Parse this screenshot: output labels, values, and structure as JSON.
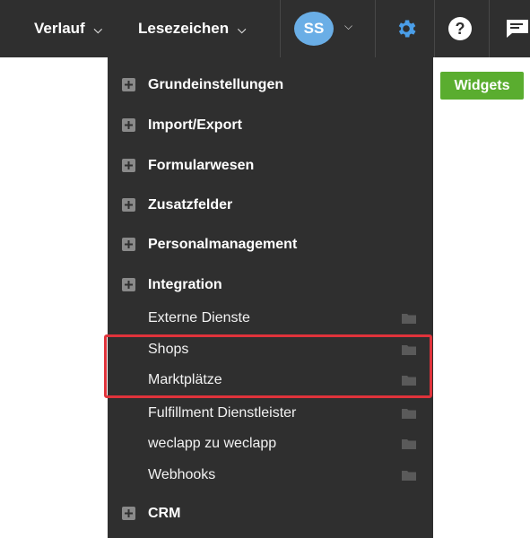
{
  "topbar": {
    "history_label": "Verlauf",
    "bookmarks_label": "Lesezeichen",
    "avatar_initials": "SS",
    "help_glyph": "?",
    "icons": {
      "history_chevron": "chevron-down-icon",
      "bookmarks_chevron": "chevron-down-icon",
      "user_chevron": "chevron-down-icon",
      "settings": "gear-icon",
      "help": "help-icon",
      "messages": "chat-icon"
    },
    "colors": {
      "bar": "#2f2f2f",
      "avatar": "#6aaee6",
      "gear": "#4a9ee8"
    }
  },
  "widgets_button": {
    "label": "Widgets",
    "color": "#5aad2f"
  },
  "settings_menu": {
    "items": [
      {
        "label": "Grundeinstellungen",
        "type": "section",
        "icon": "expand-plus-icon"
      },
      {
        "label": "Import/Export",
        "type": "section",
        "icon": "expand-plus-icon"
      },
      {
        "label": "Formularwesen",
        "type": "section",
        "icon": "expand-plus-icon"
      },
      {
        "label": "Zusatzfelder",
        "type": "section",
        "icon": "expand-plus-icon"
      },
      {
        "label": "Personalmanagement",
        "type": "section",
        "icon": "expand-plus-icon"
      },
      {
        "label": "Integration",
        "type": "section",
        "icon": "expand-plus-icon",
        "expanded": true
      },
      {
        "label": "Externe Dienste",
        "type": "subitem",
        "icon": "folder-icon"
      },
      {
        "label": "Shops",
        "type": "subitem",
        "icon": "folder-icon",
        "highlighted": true
      },
      {
        "label": "Marktplätze",
        "type": "subitem",
        "icon": "folder-icon",
        "highlighted": true
      },
      {
        "label": "Fulfillment Dienstleister",
        "type": "subitem",
        "icon": "folder-icon"
      },
      {
        "label": "weclapp zu weclapp",
        "type": "subitem",
        "icon": "folder-icon"
      },
      {
        "label": "Webhooks",
        "type": "subitem",
        "icon": "folder-icon"
      },
      {
        "label": "CRM",
        "type": "section",
        "icon": "expand-plus-icon"
      }
    ],
    "highlight_color": "#e0333b"
  }
}
